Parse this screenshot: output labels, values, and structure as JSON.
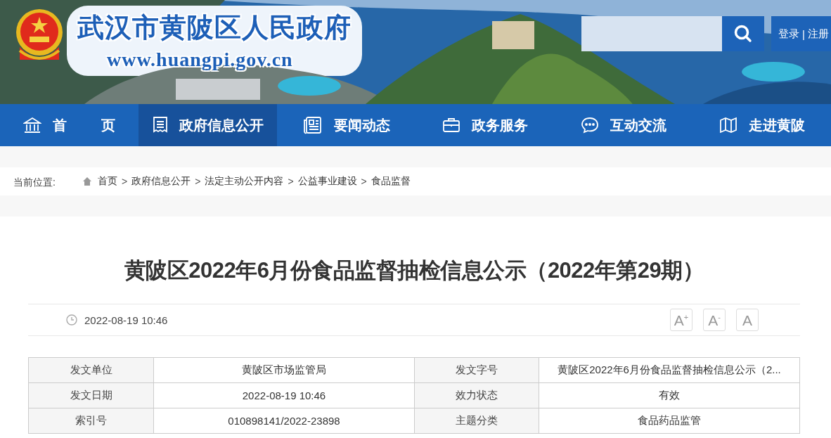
{
  "header": {
    "site_title": "武汉市黄陂区人民政府",
    "site_url": "www.huangpi.gov.cn",
    "account_links": [
      "登录",
      "注册"
    ],
    "separator": "|"
  },
  "nav": [
    {
      "label": "首 页",
      "selected": false
    },
    {
      "label": "政府信息公开",
      "selected": true
    },
    {
      "label": "要闻动态",
      "selected": false
    },
    {
      "label": "政务服务",
      "selected": false
    },
    {
      "label": "互动交流",
      "selected": false
    },
    {
      "label": "走进黄陂",
      "selected": false
    }
  ],
  "breadcrumb": {
    "label": "当前位置:",
    "items": [
      "首页",
      "政府信息公开",
      "法定主动公开内容",
      "公益事业建设",
      "食品监督"
    ],
    "separator": ">"
  },
  "article": {
    "title": "黄陂区2022年6月份食品监督抽检信息公示（2022年第29期）",
    "date": "2022-08-19 10:46",
    "font_buttons": [
      "A$^{+}$",
      "A$^{-}$",
      "A"
    ]
  },
  "info_table": {
    "rows": [
      [
        "发文单位",
        "黄陂区市场监管局",
        "发文字号",
        "黄陂区2022年6月份食品监督抽检信息公示（2..."
      ],
      [
        "发文日期",
        "2022-08-19 10:46",
        "效力状态",
        "有效"
      ],
      [
        "索引号",
        "010898141/2022-23898",
        "主题分类",
        "食品药品监管"
      ]
    ]
  }
}
